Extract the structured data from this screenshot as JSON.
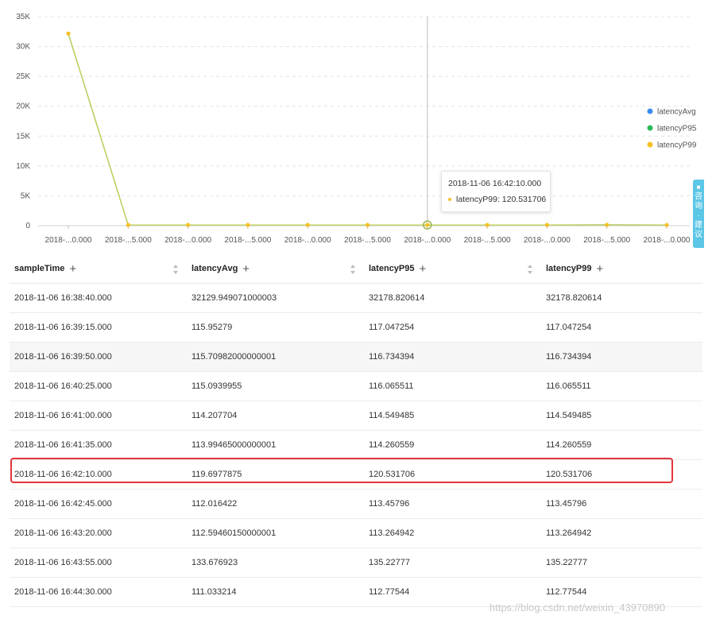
{
  "chart_data": {
    "type": "line",
    "x": [
      "2018-11-06 16:38:40.000",
      "2018-11-06 16:39:15.000",
      "2018-11-06 16:39:50.000",
      "2018-11-06 16:40:25.000",
      "2018-11-06 16:41:00.000",
      "2018-11-06 16:41:35.000",
      "2018-11-06 16:42:10.000",
      "2018-11-06 16:42:45.000",
      "2018-11-06 16:43:20.000",
      "2018-11-06 16:43:55.000",
      "2018-11-06 16:44:30.000"
    ],
    "x_tick_labels": [
      "2018-...0.000",
      "2018-...5.000",
      "2018-...0.000",
      "2018-...5.000",
      "2018-...0.000",
      "2018-...5.000",
      "2018-...0.000",
      "2018-...5.000",
      "2018-...0.000",
      "2018-...5.000",
      "2018-...0.000"
    ],
    "series": [
      {
        "name": "latencyAvg",
        "color": "#3b8cf0",
        "values": [
          32129.949071000003,
          115.95279,
          115.70982000000001,
          115.0939955,
          114.207704,
          113.99465000000001,
          119.6977875,
          112.016422,
          112.59460150000001,
          133.676923,
          111.033214
        ]
      },
      {
        "name": "latencyP95",
        "color": "#2db857",
        "values": [
          32178.820614,
          117.047254,
          116.734394,
          116.065511,
          114.549485,
          114.260559,
          120.531706,
          113.45796,
          113.264942,
          135.22777,
          112.77544
        ]
      },
      {
        "name": "latencyP99",
        "color": "#f5c028",
        "values": [
          32178.820614,
          117.047254,
          116.734394,
          116.065511,
          114.549485,
          114.260559,
          120.531706,
          113.45796,
          113.264942,
          135.22777,
          112.77544
        ]
      }
    ],
    "y_ticks": [
      0,
      5000,
      10000,
      15000,
      20000,
      25000,
      30000,
      35000
    ],
    "y_tick_labels": [
      "0",
      "5K",
      "10K",
      "15K",
      "20K",
      "25K",
      "30K",
      "35K"
    ],
    "ylim": [
      0,
      35000
    ],
    "grid": true,
    "legend_position": "right",
    "hover_index": 6
  },
  "tooltip": {
    "time": "2018-11-06 16:42:10.000",
    "text": "latencyP99: 120.531706",
    "dot_color": "#f5c028"
  },
  "side_tab": {
    "chars": [
      "咨",
      "询",
      "·",
      "建",
      "议"
    ]
  },
  "table": {
    "columns": [
      "sampleTime",
      "latencyAvg",
      "latencyP95",
      "latencyP99"
    ],
    "add_symbol": "+",
    "rows": [
      [
        "2018-11-06 16:38:40.000",
        "32129.949071000003",
        "32178.820614",
        "32178.820614"
      ],
      [
        "2018-11-06 16:39:15.000",
        "115.95279",
        "117.047254",
        "117.047254"
      ],
      [
        "2018-11-06 16:39:50.000",
        "115.70982000000001",
        "116.734394",
        "116.734394"
      ],
      [
        "2018-11-06 16:40:25.000",
        "115.0939955",
        "116.065511",
        "116.065511"
      ],
      [
        "2018-11-06 16:41:00.000",
        "114.207704",
        "114.549485",
        "114.549485"
      ],
      [
        "2018-11-06 16:41:35.000",
        "113.99465000000001",
        "114.260559",
        "114.260559"
      ],
      [
        "2018-11-06 16:42:10.000",
        "119.6977875",
        "120.531706",
        "120.531706"
      ],
      [
        "2018-11-06 16:42:45.000",
        "112.016422",
        "113.45796",
        "113.45796"
      ],
      [
        "2018-11-06 16:43:20.000",
        "112.59460150000001",
        "113.264942",
        "113.264942"
      ],
      [
        "2018-11-06 16:43:55.000",
        "133.676923",
        "135.22777",
        "135.22777"
      ],
      [
        "2018-11-06 16:44:30.000",
        "111.033214",
        "112.77544",
        "112.77544"
      ]
    ],
    "alt_rows": [
      2
    ]
  },
  "watermark": "https://blog.csdn.net/weixin_43970890"
}
